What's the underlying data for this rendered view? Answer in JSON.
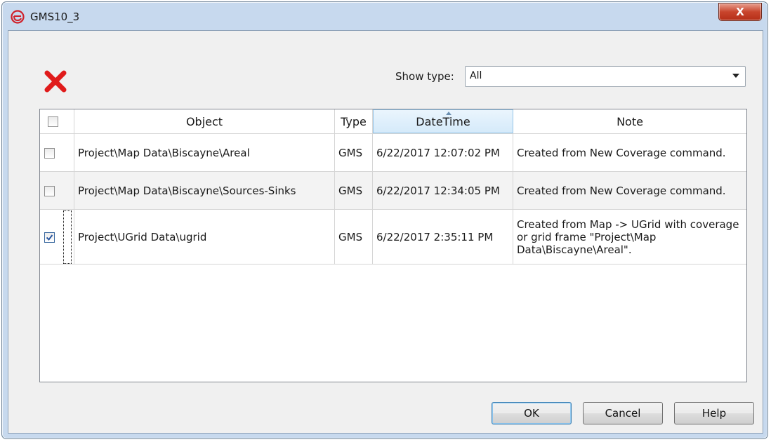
{
  "window": {
    "title": "GMS10_3",
    "close_glyph": "X"
  },
  "toolbar": {
    "delete_icon": "red-x-icon"
  },
  "filter": {
    "label": "Show type:",
    "value": "All"
  },
  "table": {
    "columns": [
      "Object",
      "Type",
      "DateTime",
      "Note"
    ],
    "sorted_column": "DateTime",
    "rows": [
      {
        "checked": false,
        "object": "Project\\Map Data\\Biscayne\\Areal",
        "type": "GMS",
        "datetime": "6/22/2017 12:07:02 PM",
        "note": "Created from New Coverage command."
      },
      {
        "checked": false,
        "object": "Project\\Map Data\\Biscayne\\Sources-Sinks",
        "type": "GMS",
        "datetime": "6/22/2017 12:34:05 PM",
        "note": "Created from New Coverage command."
      },
      {
        "checked": true,
        "object": "Project\\UGrid Data\\ugrid",
        "type": "GMS",
        "datetime": "6/22/2017 2:35:11 PM",
        "note": "Created from Map -> UGrid with coverage or grid frame \"Project\\Map Data\\Biscayne\\Areal\"."
      }
    ]
  },
  "buttons": {
    "ok": "OK",
    "cancel": "Cancel",
    "help": "Help"
  },
  "colors": {
    "accent": "#3c7fb1",
    "delete_red": "#e01b1b",
    "close_red": "#c8442c"
  }
}
